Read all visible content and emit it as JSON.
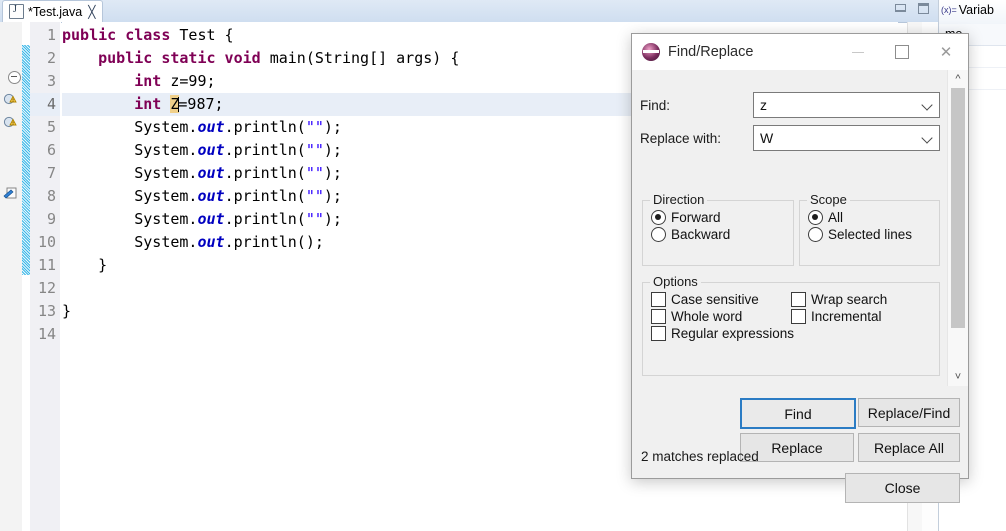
{
  "editor": {
    "tab": {
      "title": "*Test.java",
      "icon": "java-file-icon",
      "close_icon": "close-icon"
    },
    "part_buttons": {
      "minimize": "minimize-icon",
      "maximize": "maximize-icon"
    },
    "line_numbers": [
      "1",
      "2",
      "3",
      "4",
      "5",
      "6",
      "7",
      "8",
      "9",
      "10",
      "11",
      "12",
      "13",
      "14"
    ],
    "current_line": 4,
    "code_lines": [
      {
        "n": "1",
        "segments": [
          {
            "t": "public ",
            "c": "kw"
          },
          {
            "t": "class ",
            "c": "kw"
          },
          {
            "t": "Test {",
            "c": "plain"
          }
        ]
      },
      {
        "n": "2",
        "segments": [
          {
            "t": "    ",
            "c": "plain"
          },
          {
            "t": "public static void ",
            "c": "kw"
          },
          {
            "t": "main(",
            "c": "plain"
          },
          {
            "t": "String",
            "c": "plain"
          },
          {
            "t": "[] ",
            "c": "plain"
          },
          {
            "t": "args",
            "c": "arg"
          },
          {
            "t": ") {",
            "c": "plain"
          }
        ]
      },
      {
        "n": "3",
        "segments": [
          {
            "t": "        ",
            "c": "plain"
          },
          {
            "t": "int ",
            "c": "kw"
          },
          {
            "t": "z=99;",
            "c": "plain"
          }
        ]
      },
      {
        "n": "4",
        "segments": [
          {
            "t": "        ",
            "c": "plain"
          },
          {
            "t": "int ",
            "c": "kw"
          },
          {
            "t": "Z",
            "c": "occ"
          },
          {
            "t": "=987;",
            "c": "plain"
          }
        ]
      },
      {
        "n": "5",
        "segments": [
          {
            "t": "        System.",
            "c": "plain"
          },
          {
            "t": "out",
            "c": "fieldv"
          },
          {
            "t": ".println(",
            "c": "plain"
          },
          {
            "t": "\"\"",
            "c": "str"
          },
          {
            "t": ");",
            "c": "plain"
          }
        ]
      },
      {
        "n": "6",
        "segments": [
          {
            "t": "        System.",
            "c": "plain"
          },
          {
            "t": "out",
            "c": "fieldv"
          },
          {
            "t": ".println(",
            "c": "plain"
          },
          {
            "t": "\"\"",
            "c": "str"
          },
          {
            "t": ");",
            "c": "plain"
          }
        ]
      },
      {
        "n": "7",
        "segments": [
          {
            "t": "        System.",
            "c": "plain"
          },
          {
            "t": "out",
            "c": "fieldv"
          },
          {
            "t": ".println(",
            "c": "plain"
          },
          {
            "t": "\"\"",
            "c": "str"
          },
          {
            "t": ");",
            "c": "plain"
          }
        ]
      },
      {
        "n": "8",
        "segments": [
          {
            "t": "        System.",
            "c": "plain"
          },
          {
            "t": "out",
            "c": "fieldv"
          },
          {
            "t": ".println(",
            "c": "plain"
          },
          {
            "t": "\"\"",
            "c": "str"
          },
          {
            "t": ");",
            "c": "plain"
          }
        ]
      },
      {
        "n": "9",
        "segments": [
          {
            "t": "        System.",
            "c": "plain"
          },
          {
            "t": "out",
            "c": "fieldv"
          },
          {
            "t": ".println(",
            "c": "plain"
          },
          {
            "t": "\"\"",
            "c": "str"
          },
          {
            "t": ");",
            "c": "plain"
          }
        ]
      },
      {
        "n": "10",
        "segments": [
          {
            "t": "        System.",
            "c": "plain"
          },
          {
            "t": "out",
            "c": "fieldv"
          },
          {
            "t": ".println();",
            "c": "plain"
          }
        ]
      },
      {
        "n": "11",
        "segments": [
          {
            "t": "    }",
            "c": "plain"
          }
        ]
      },
      {
        "n": "12",
        "segments": [
          {
            "t": "",
            "c": "plain"
          }
        ]
      },
      {
        "n": "13",
        "segments": [
          {
            "t": "}",
            "c": "plain"
          }
        ]
      },
      {
        "n": "14",
        "segments": [
          {
            "t": "",
            "c": "plain"
          }
        ]
      }
    ],
    "gutter_markers": [
      {
        "line": 3,
        "icon": "warning-icon"
      },
      {
        "line": 4,
        "icon": "warning-icon"
      },
      {
        "line": 7,
        "icon": "quickfix-icon"
      }
    ],
    "folding_markers": [
      {
        "line": 2,
        "icon": "collapse-icon"
      }
    ],
    "colors": {
      "keyword": "#7f0055",
      "string": "#2a00ff",
      "field": "#0000c0",
      "occurrence_highlight": "#f0d08a",
      "current_line": "#e8eef7",
      "change_bar": "#7fd4f0"
    }
  },
  "right_view": {
    "tab_label": "Variab",
    "tab_icon": "variables-icon",
    "column_header": "me"
  },
  "find_dialog": {
    "title": "Find/Replace",
    "logo_icon": "eclipse-logo-icon",
    "window_buttons": {
      "minimize": "minimize-icon",
      "maximize": "maximize-icon",
      "close": "close-icon"
    },
    "find_label": "Find:",
    "find_value": "z",
    "replace_label": "Replace with:",
    "replace_value": "W",
    "direction": {
      "legend": "Direction",
      "options": [
        {
          "label": "Forward",
          "selected": true
        },
        {
          "label": "Backward",
          "selected": false
        }
      ]
    },
    "scope": {
      "legend": "Scope",
      "options": [
        {
          "label": "All",
          "selected": true
        },
        {
          "label": "Selected lines",
          "selected": false
        }
      ]
    },
    "options": {
      "legend": "Options",
      "items": [
        {
          "label": "Case sensitive",
          "checked": false
        },
        {
          "label": "Wrap search",
          "checked": false
        },
        {
          "label": "Whole word",
          "checked": false
        },
        {
          "label": "Incremental",
          "checked": false
        },
        {
          "label": "Regular expressions",
          "checked": false
        }
      ]
    },
    "buttons": {
      "find": "Find",
      "replace_find": "Replace/Find",
      "replace": "Replace",
      "replace_all": "Replace All",
      "close": "Close"
    },
    "status": "2 matches replaced",
    "focused_button": "Find",
    "accent": "#2b7cc4"
  }
}
